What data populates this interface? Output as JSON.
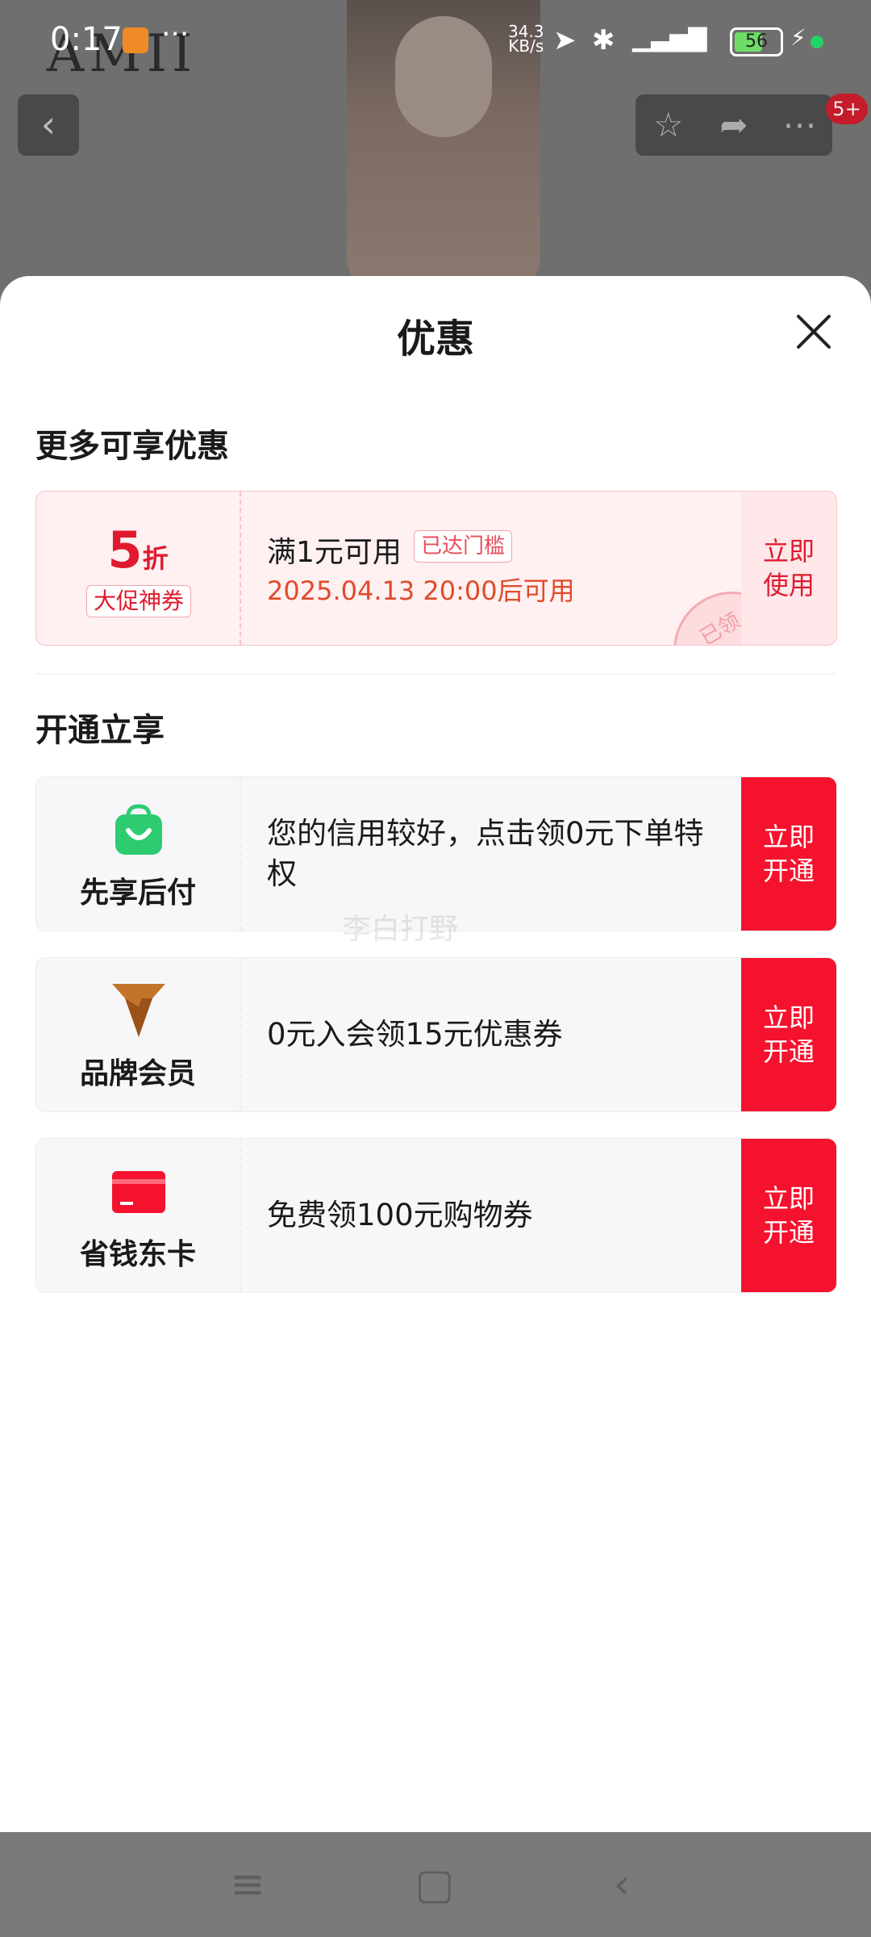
{
  "status_bar": {
    "time": "0:17",
    "more": "···",
    "net_speed_value": "34.3",
    "net_speed_unit": "KB/s",
    "battery": "56"
  },
  "backdrop": {
    "brand": "AMII",
    "cart_badge": "5+"
  },
  "sheet": {
    "title": "优惠",
    "section_more": "更多可享优惠",
    "coupon": {
      "discount_value": "5",
      "discount_unit": "折",
      "tag": "大促神券",
      "condition": "满1元可用",
      "met_badge": "已达门槛",
      "validity": "2025.04.13 20:00后可用",
      "action": "立即使用",
      "stamp": "已领"
    },
    "section_open": "开通立享",
    "benefits": [
      {
        "name": "先享后付",
        "desc": "您的信用较好，点击领0元下单特权",
        "action": "立即开通",
        "icon": "shopping-bag-icon"
      },
      {
        "name": "品牌会员",
        "desc": "0元入会领15元优惠券",
        "action": "立即开通",
        "icon": "brand-v-icon"
      },
      {
        "name": "省钱东卡",
        "desc": "免费领100元购物券",
        "action": "立即开通",
        "icon": "card-icon"
      }
    ],
    "watermark": "李白打野"
  },
  "colors": {
    "accent": "#f5122e",
    "coupon_bg": "#fff0f1",
    "green": "#2ecc71",
    "bronze": "#b86a28"
  }
}
